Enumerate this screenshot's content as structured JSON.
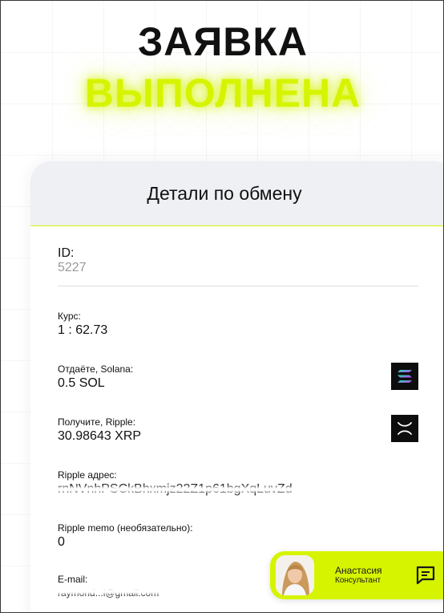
{
  "hero": {
    "title_line1": "ЗАЯВКА",
    "title_line2": "ВЫПОЛНЕНА"
  },
  "card": {
    "title": "Детали по обмену",
    "id_label": "ID:",
    "id_value": "5227",
    "rate_label": "Курс:",
    "rate_value": "1 : 62.73",
    "give_label": "Отдаёте, Solana:",
    "give_value": "0.5 SOL",
    "receive_label": "Получите, Ripple:",
    "receive_value": "30.98643 XRP",
    "address_label": "Ripple адрес:",
    "address_value": "rnNVnhPSCkBhxmjz22Z1p61bgXqLuvZd",
    "memo_label": "Ripple memo (необязательно):",
    "memo_value": "0",
    "email_label": "E-mail:",
    "email_value": "raymond...l@gmail.com"
  },
  "chat": {
    "agent_name": "Анастасия",
    "agent_role": "Консультант"
  },
  "colors": {
    "accent": "#d6f400",
    "header_bg": "#eef0f3",
    "icon_bg": "#0d0d0d"
  }
}
